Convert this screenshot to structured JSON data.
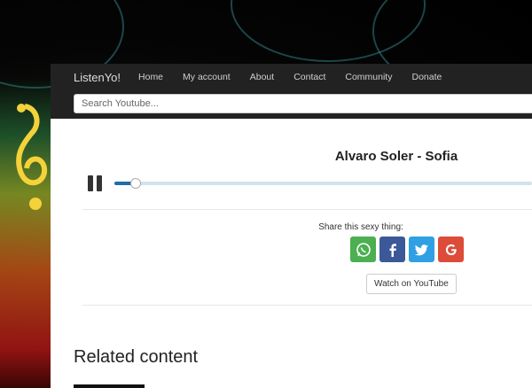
{
  "navbar": {
    "brand": "ListenYo!",
    "links": [
      "Home",
      "My account",
      "About",
      "Contact",
      "Community",
      "Donate"
    ]
  },
  "search": {
    "placeholder": "Search Youtube..."
  },
  "player": {
    "title": "Alvaro Soler - Sofia",
    "progress": 0.05,
    "state_icon": "pause-icon"
  },
  "share": {
    "label": "Share this sexy thing:",
    "buttons": [
      {
        "name": "whatsapp",
        "color": "#4caf50"
      },
      {
        "name": "facebook",
        "color": "#3b5998"
      },
      {
        "name": "twitter",
        "color": "#2ea0e3"
      },
      {
        "name": "google",
        "color": "#dd4b39"
      }
    ],
    "youtube_label": "Watch on YouTube"
  },
  "related": {
    "title": "Related content"
  }
}
